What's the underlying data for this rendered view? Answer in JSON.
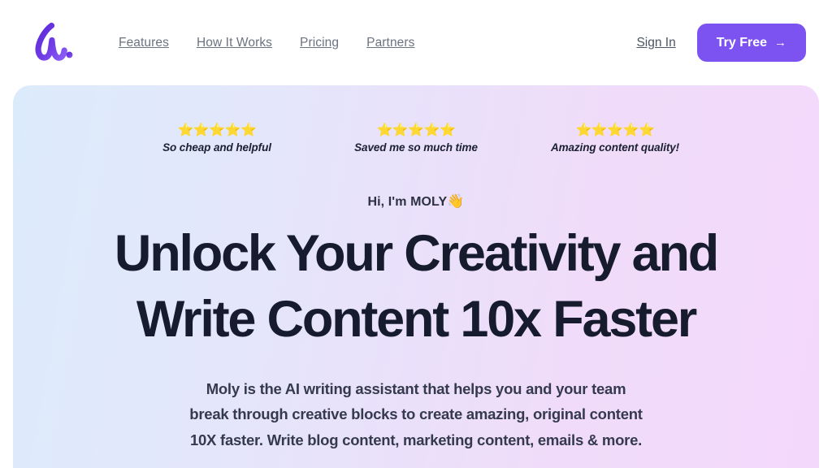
{
  "header": {
    "logo": {
      "icon": "moly-script-logo",
      "alt": "Moly"
    },
    "nav_items": [
      {
        "label": "Features"
      },
      {
        "label": "How It Works"
      },
      {
        "label": "Pricing"
      },
      {
        "label": "Partners"
      }
    ],
    "sign_in_label": "Sign In",
    "cta": {
      "label": "Try Free",
      "arrow": "→",
      "color": "#7c53f0"
    }
  },
  "hero": {
    "background": {
      "from": "#dcebfb",
      "to": "#f4d8fb"
    },
    "testimonials": [
      {
        "stars": "⭐⭐⭐⭐⭐",
        "text": "So cheap and helpful"
      },
      {
        "stars": "⭐⭐⭐⭐⭐",
        "text": "Saved me so much time"
      },
      {
        "stars": "⭐⭐⭐⭐⭐",
        "text": "Amazing content quality!"
      }
    ],
    "greeting": {
      "text": "Hi, I'm MOLY",
      "emoji": "👋"
    },
    "headline": {
      "line1": "Unlock Your Creativity and",
      "line2": "Write Content 10x Faster",
      "color": "#161b2e"
    },
    "subtext": {
      "line1": "Moly is the AI writing assistant that helps you and your team",
      "line2": "break through creative blocks to create amazing, original content",
      "line3": "10X faster. Write blog content, marketing content, emails & more."
    }
  }
}
